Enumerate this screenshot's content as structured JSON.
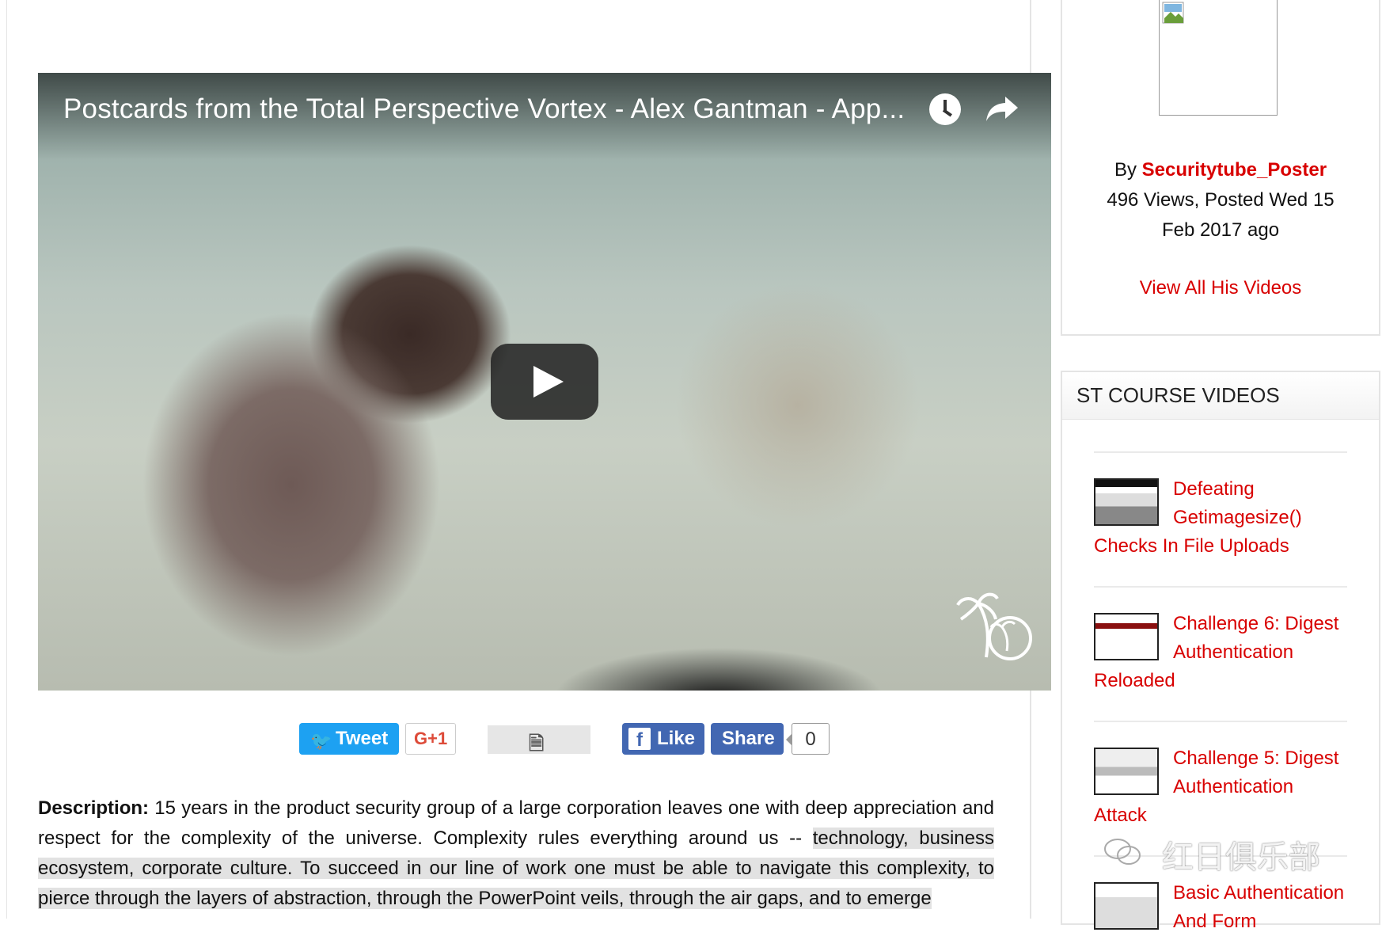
{
  "video": {
    "title": "Postcards from the Total Perspective Vortex - Alex Gantman - App..."
  },
  "social": {
    "tweet_label": "Tweet",
    "gplus_label": "G+1",
    "like_label": "Like",
    "share_label": "Share",
    "share_count": "0"
  },
  "description": {
    "label": "Description:",
    "text_plain": " 15 years in the product security group of a large corporation leaves one with deep appreciation and respect for the complexity of the universe. Complexity rules everything around us -- ",
    "text_highlight": "technology, business ecosystem, corporate culture. To succeed in our line of work one must be able to navigate this complexity, to pierce through the layers of abstraction, through the PowerPoint veils, through the air gaps, and to emerge"
  },
  "author": {
    "by_prefix": "By ",
    "name": "Securitytube_Poster",
    "stats": "496 Views, Posted Wed 15 Feb 2017 ago",
    "view_all": "View All His Videos"
  },
  "course_videos": {
    "heading": "ST COURSE VIDEOS",
    "items": [
      {
        "title": "Defeating Getimagesize() Checks In File Uploads"
      },
      {
        "title": "Challenge 6: Digest Authentication Reloaded"
      },
      {
        "title": "Challenge 5: Digest Authentication Attack"
      },
      {
        "title": "Basic Authentication And Form"
      }
    ]
  },
  "watermark": {
    "text": "红日俱乐部"
  },
  "colors": {
    "link_red": "#d80000",
    "twitter_blue": "#1da1f2",
    "facebook_blue": "#4267b2"
  }
}
